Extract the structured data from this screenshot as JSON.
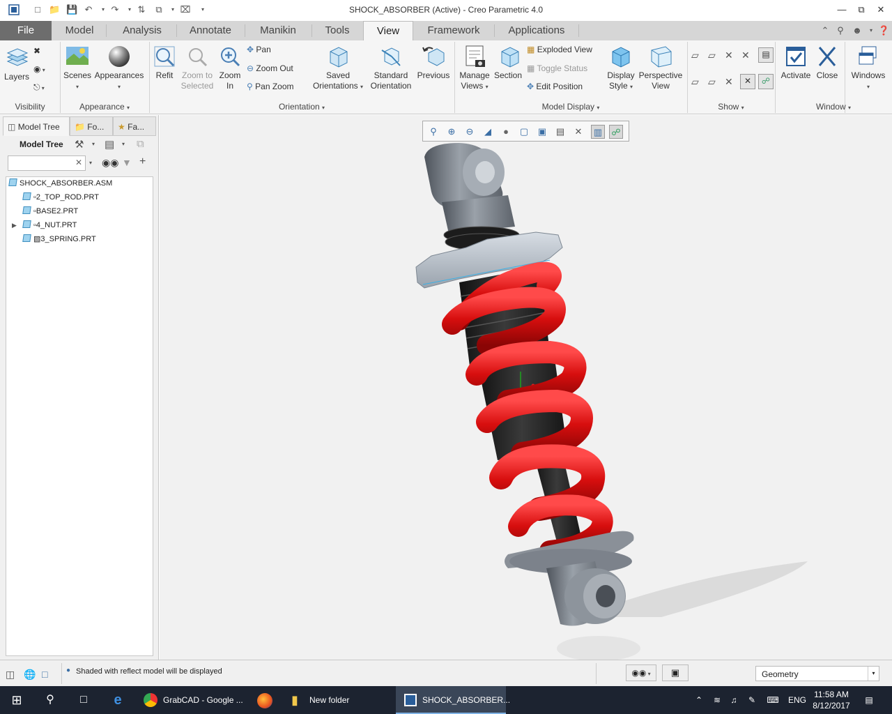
{
  "window": {
    "title": "SHOCK_ABSORBER (Active) - Creo Parametric 4.0"
  },
  "tabs": [
    {
      "label": "File"
    },
    {
      "label": "Model"
    },
    {
      "label": "Analysis"
    },
    {
      "label": "Annotate"
    },
    {
      "label": "Manikin"
    },
    {
      "label": "Tools"
    },
    {
      "label": "View"
    },
    {
      "label": "Framework"
    },
    {
      "label": "Applications"
    }
  ],
  "ribbon": {
    "visibility": {
      "layers": "Layers",
      "group": "Visibility"
    },
    "appearance": {
      "scenes": "Scenes",
      "appearances": "Appearances",
      "group": "Appearance"
    },
    "orientation": {
      "refit": "Refit",
      "zoom_to_selected_1": "Zoom to",
      "zoom_to_selected_2": "Selected",
      "zoom_in_1": "Zoom",
      "zoom_in_2": "In",
      "pan": "Pan",
      "zoom_out": "Zoom Out",
      "pan_zoom": "Pan Zoom",
      "saved_1": "Saved",
      "saved_2": "Orientations",
      "standard_1": "Standard",
      "standard_2": "Orientation",
      "previous": "Previous",
      "group": "Orientation"
    },
    "model_display": {
      "manage_1": "Manage",
      "manage_2": "Views",
      "section": "Section",
      "exploded_view": "Exploded View",
      "toggle_status": "Toggle Status",
      "edit_position": "Edit Position",
      "display_1": "Display",
      "display_2": "Style",
      "perspective_1": "Perspective",
      "perspective_2": "View",
      "group": "Model Display"
    },
    "show": {
      "group": "Show"
    },
    "window": {
      "activate": "Activate",
      "close": "Close",
      "windows": "Windows",
      "group": "Window"
    }
  },
  "left_panel": {
    "tabs": [
      "Model Tree",
      "Fo...",
      "Fa..."
    ],
    "header": "Model Tree",
    "search_value": "",
    "tree": [
      {
        "label": "SHOCK_ABSORBER.ASM",
        "level": 0,
        "expandable": false
      },
      {
        "label": "2_TOP_ROD.PRT",
        "level": 1,
        "expandable": false
      },
      {
        "label": "BASE2.PRT",
        "level": 1,
        "expandable": false
      },
      {
        "label": "4_NUT.PRT",
        "level": 1,
        "expandable": true
      },
      {
        "label": "3_SPRING.PRT",
        "level": 1,
        "expandable": false
      }
    ]
  },
  "statusbar": {
    "message": "Shaded with reflect model will be displayed",
    "filter_value": "Geometry"
  },
  "taskbar": {
    "apps": [
      {
        "label": "GrabCAD - Google ..."
      },
      {
        "label": "New folder"
      },
      {
        "label": "SHOCK_ABSORBER..."
      }
    ],
    "lang": "ENG",
    "time": "11:58 AM",
    "date": "8/12/2017"
  },
  "colors": {
    "spring": "#e01414",
    "metal": "#7f858e",
    "accent": "#3a6ea5"
  }
}
